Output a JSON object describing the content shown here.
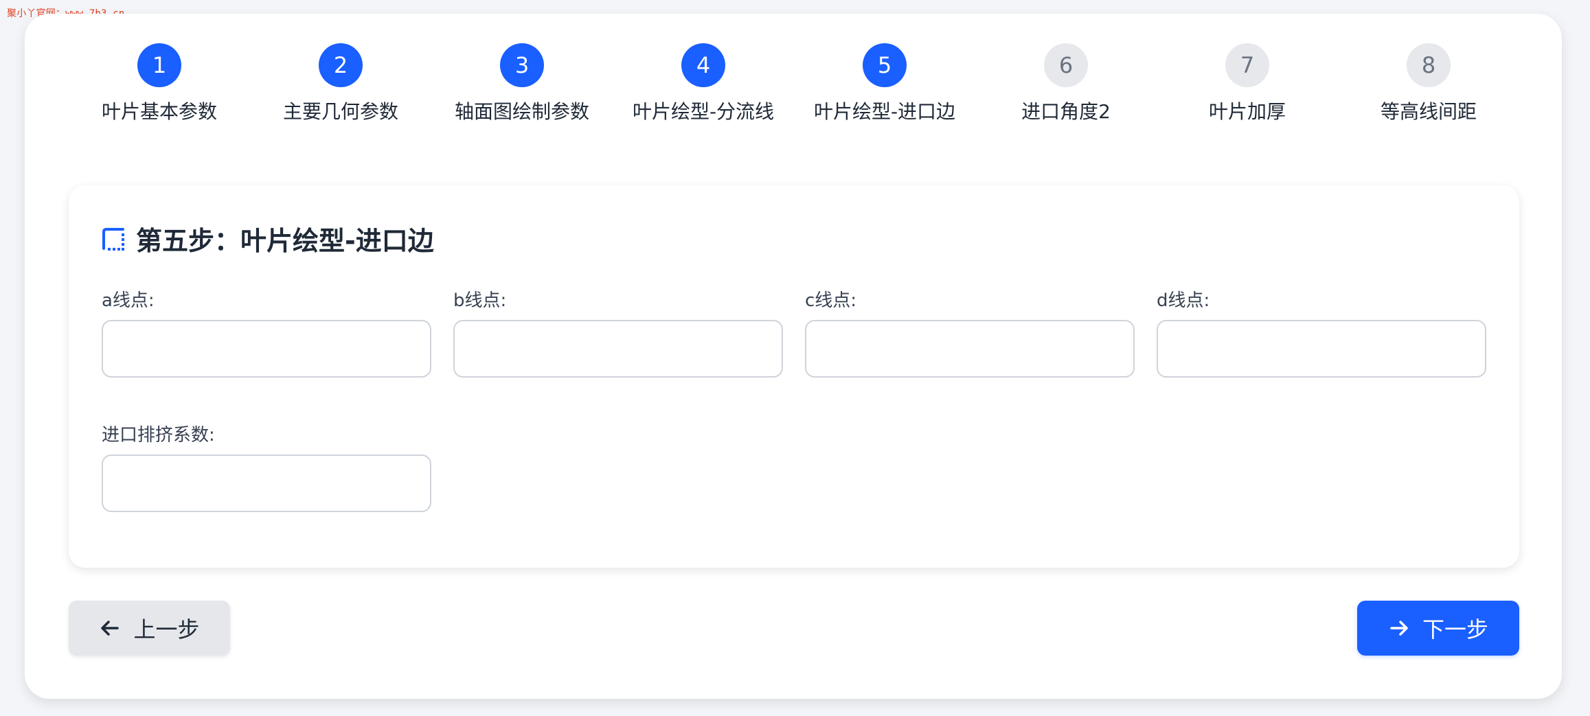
{
  "watermark": "聚小丫官网：www.7b3.cn",
  "stepper": {
    "steps": [
      {
        "number": "1",
        "label": "叶片基本参数",
        "state": "active"
      },
      {
        "number": "2",
        "label": "主要几何参数",
        "state": "active"
      },
      {
        "number": "3",
        "label": "轴面图绘制参数",
        "state": "active"
      },
      {
        "number": "4",
        "label": "叶片绘型-分流线",
        "state": "active"
      },
      {
        "number": "5",
        "label": "叶片绘型-进口边",
        "state": "active"
      },
      {
        "number": "6",
        "label": "进口角度2",
        "state": "inactive"
      },
      {
        "number": "7",
        "label": "叶片加厚",
        "state": "inactive"
      },
      {
        "number": "8",
        "label": "等高线间距",
        "state": "inactive"
      }
    ]
  },
  "form": {
    "title": "第五步：叶片绘型-进口边",
    "title_icon": "dotted-square-icon",
    "fields": {
      "a_line": {
        "label": "a线点:",
        "value": ""
      },
      "b_line": {
        "label": "b线点:",
        "value": ""
      },
      "c_line": {
        "label": "c线点:",
        "value": ""
      },
      "d_line": {
        "label": "d线点:",
        "value": ""
      },
      "inlet_coeff": {
        "label": "进口排挤系数:",
        "value": ""
      }
    }
  },
  "nav": {
    "prev_label": "上一步",
    "prev_icon": "arrow-left-icon",
    "next_label": "下一步",
    "next_icon": "arrow-right-icon"
  },
  "colors": {
    "accent": "#1a5fff",
    "inactive_step": "#e6e8ec",
    "background": "#f3f5f9"
  }
}
